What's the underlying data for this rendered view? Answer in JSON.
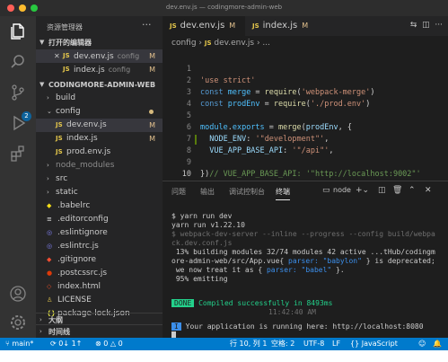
{
  "window": {
    "title": "dev.env.js — codingmore-admin-web",
    "traffic_colors": [
      "#ff5f57",
      "#febc2e",
      "#28c840"
    ]
  },
  "activity_bar": {
    "scm_badge": "2",
    "icons": [
      "files-icon",
      "search-icon",
      "source-control-icon",
      "run-debug-icon",
      "extensions-icon",
      "account-icon",
      "settings-gear-icon"
    ]
  },
  "sidebar": {
    "header": "资源管理器",
    "more": "···",
    "open_editors": {
      "title": "打开的编辑器",
      "items": [
        {
          "name": "dev.env.js",
          "desc": "config",
          "mark": "M"
        },
        {
          "name": "index.js",
          "desc": "config",
          "mark": "M"
        }
      ]
    },
    "project": {
      "title": "CODINGMORE-ADMIN-WEB",
      "tree": [
        {
          "name": "build",
          "type": "folder"
        },
        {
          "name": "config",
          "type": "folder-open"
        },
        {
          "name": "dev.env.js",
          "type": "js",
          "mark": "M"
        },
        {
          "name": "index.js",
          "type": "js",
          "mark": "M"
        },
        {
          "name": "prod.env.js",
          "type": "js"
        },
        {
          "name": "node_modules",
          "type": "folder"
        },
        {
          "name": "src",
          "type": "folder"
        },
        {
          "name": "static",
          "type": "folder"
        },
        {
          "name": ".babelrc",
          "type": "file"
        },
        {
          "name": ".editorconfig",
          "type": "file"
        },
        {
          "name": ".eslintignore",
          "type": "file"
        },
        {
          "name": ".eslintrc.js",
          "type": "file"
        },
        {
          "name": ".gitignore",
          "type": "file"
        },
        {
          "name": ".postcssrc.js",
          "type": "file"
        },
        {
          "name": "index.html",
          "type": "file"
        },
        {
          "name": "LICENSE",
          "type": "file"
        },
        {
          "name": "package-lock.json",
          "type": "file"
        }
      ]
    },
    "outline": "大纲",
    "timeline": "时间线"
  },
  "editor": {
    "tabs": [
      {
        "label": "dev.env.js",
        "mark": "M",
        "active": true
      },
      {
        "label": "index.js",
        "mark": "M",
        "active": false
      }
    ],
    "breadcrumb": [
      "config",
      "dev.env.js",
      "..."
    ],
    "line_numbers": [
      "1",
      "2",
      "3",
      "4",
      "5",
      "6",
      "7",
      "8",
      "9",
      "10"
    ],
    "code": {
      "l1": "'use strict'",
      "l2_kw": "const",
      "l2_var": "merge",
      "l2_fn": "require",
      "l2_str": "'webpack-merge'",
      "l3_kw": "const",
      "l3_var": "prodEnv",
      "l3_fn": "require",
      "l3_str": "'./prod.env'",
      "l5_obj": "module",
      "l5_prop": "exports",
      "l5_fn": "merge",
      "l5_arg": "prodEnv",
      "l6_key": "NODE_ENV",
      "l6_val": "'\"development\"'",
      "l7_key": "VUE_APP_BASE_API",
      "l7_val": "'\"/api\"'",
      "l8_comment": "// VUE_APP_BASE_API: '\"http://localhost:9002\"'",
      "l9": "})"
    }
  },
  "panel": {
    "tabs": [
      "问题",
      "输出",
      "调试控制台",
      "终端"
    ],
    "terminal_label": "node",
    "terminal_lines": {
      "t1": "$ yarn run dev",
      "t2": "yarn run v1.22.10",
      "t3": "$ webpack-dev-server --inline --progress --config build/webpa",
      "t4": "ck.dev.conf.js",
      "t5": " 13% building modules 32/74 modules 42 active ...tHub/codingm",
      "t6a": "ore-admin-web/src/App.vue{ ",
      "t6b": "parser: \"babylon\"",
      "t6c": " } is deprecated;",
      "t7a": " we now treat it as { ",
      "t7b": "parser: \"babel\"",
      "t7c": " }.",
      "t8": " 95% emitting",
      "done_badge": "DONE",
      "done_text": " Compiled successfully in 8493ms",
      "time": "11:42:40 AM",
      "info_badge": "I",
      "info_text": " Your application is running here: http://localhost:8080"
    }
  },
  "statusbar": {
    "branch": "main*",
    "sync": "0↓ 1↑",
    "errors": "0",
    "warnings": "0",
    "position": "行 10, 列 1",
    "spaces": "空格: 2",
    "encoding": "UTF-8",
    "eol": "LF",
    "language": "JavaScript"
  }
}
